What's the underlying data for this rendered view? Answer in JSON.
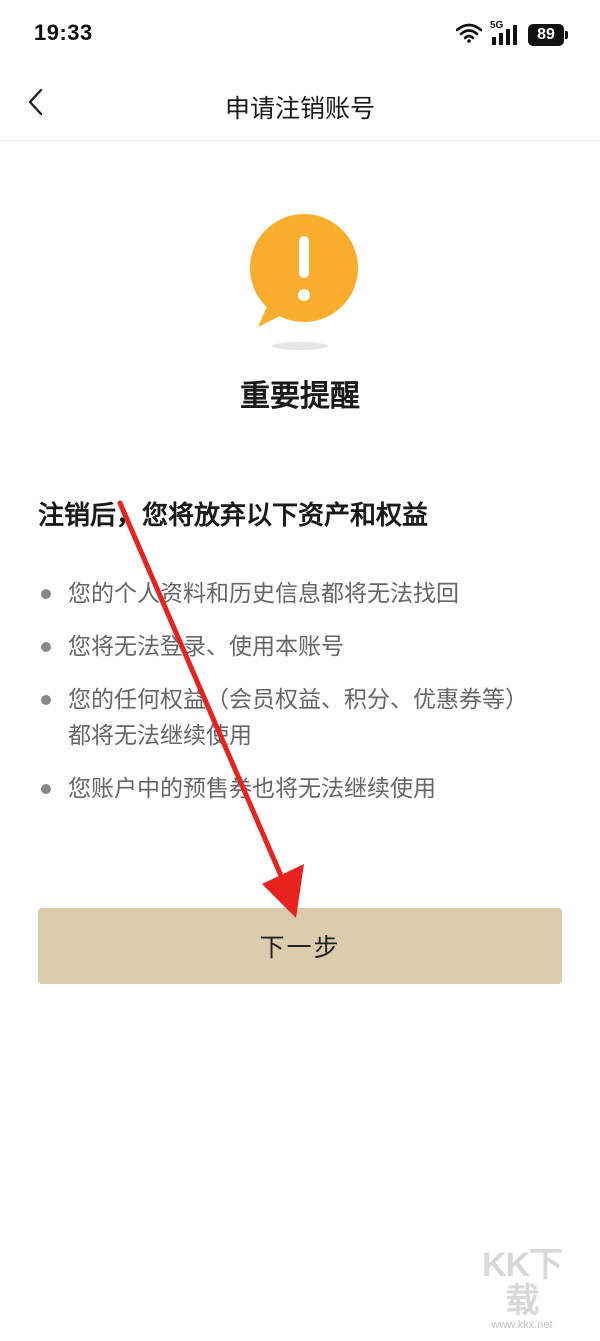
{
  "status_bar": {
    "time": "19:33",
    "network": "5G",
    "battery": "89",
    "icons": [
      "wifi-icon",
      "signal-icon",
      "battery-icon"
    ]
  },
  "nav": {
    "back_icon": "chevron-left-icon",
    "title": "申请注销账号"
  },
  "alert": {
    "icon": "exclamation-bubble-icon",
    "icon_color": "#f8ad2c",
    "heading": "重要提醒"
  },
  "rights": {
    "heading": "注销后，您将放弃以下资产和权益",
    "items": [
      {
        "text": "您的个人资料和历史信息都将无法找回"
      },
      {
        "text": "您将无法登录、使用本账号"
      },
      {
        "text": "您的任何权益（会员权益、积分、优惠券等）都将无法继续使用"
      },
      {
        "text": "您账户中的预售券也将无法继续使用"
      }
    ]
  },
  "next_button": {
    "label": "下一步",
    "color": "#dccbad"
  },
  "annotation": {
    "type": "red-arrow",
    "color": "#e8231f"
  },
  "watermark": {
    "logo": "KK下载",
    "url": "www.kkx.net"
  }
}
